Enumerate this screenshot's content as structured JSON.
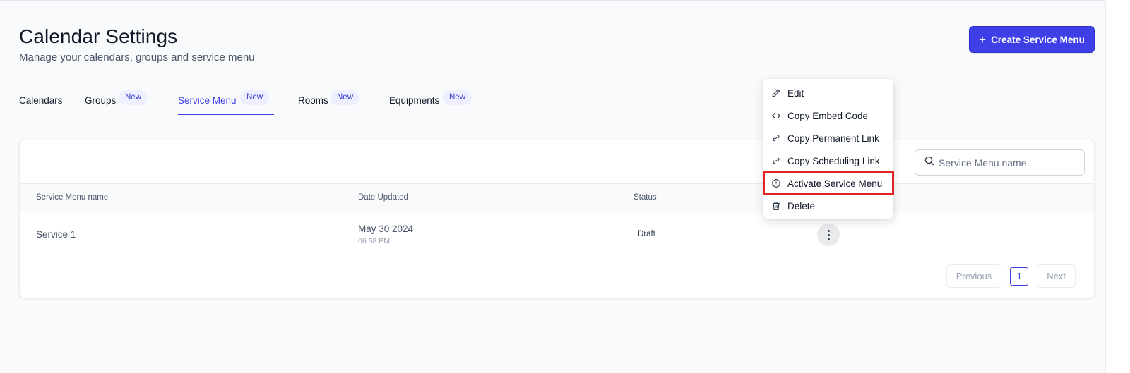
{
  "header": {
    "title": "Calendar Settings",
    "subtitle": "Manage your calendars, groups and service menu",
    "create_button": "Create Service Menu"
  },
  "tabs": [
    {
      "label": "Calendars",
      "badge": "",
      "active": false
    },
    {
      "label": "Groups",
      "badge": "New",
      "active": false
    },
    {
      "label": "Service Menu",
      "badge": "New",
      "active": true
    },
    {
      "label": "Rooms",
      "badge": "New",
      "active": false
    },
    {
      "label": "Equipments",
      "badge": "New",
      "active": false
    }
  ],
  "search": {
    "placeholder": "Service Menu name"
  },
  "table": {
    "columns": [
      "Service Menu name",
      "Date Updated",
      "Status"
    ],
    "rows": [
      {
        "name": "Service 1",
        "date": "May 30 2024",
        "time": "06 58 PM",
        "status": "Draft"
      }
    ]
  },
  "pagination": {
    "previous": "Previous",
    "page": "1",
    "next": "Next"
  },
  "context_menu": {
    "items": [
      {
        "label": "Edit",
        "icon": "pencil-icon"
      },
      {
        "label": "Copy Embed Code",
        "icon": "code-icon"
      },
      {
        "label": "Copy Permanent Link",
        "icon": "link-icon"
      },
      {
        "label": "Copy Scheduling Link",
        "icon": "link-icon"
      },
      {
        "label": "Activate Service Menu",
        "icon": "hexagon-alert-icon",
        "highlighted": true
      },
      {
        "label": "Delete",
        "icon": "trash-icon"
      }
    ]
  },
  "colors": {
    "accent": "#3f3fe8",
    "highlight_border": "#e02424",
    "badge_bg": "#eef0ff"
  }
}
